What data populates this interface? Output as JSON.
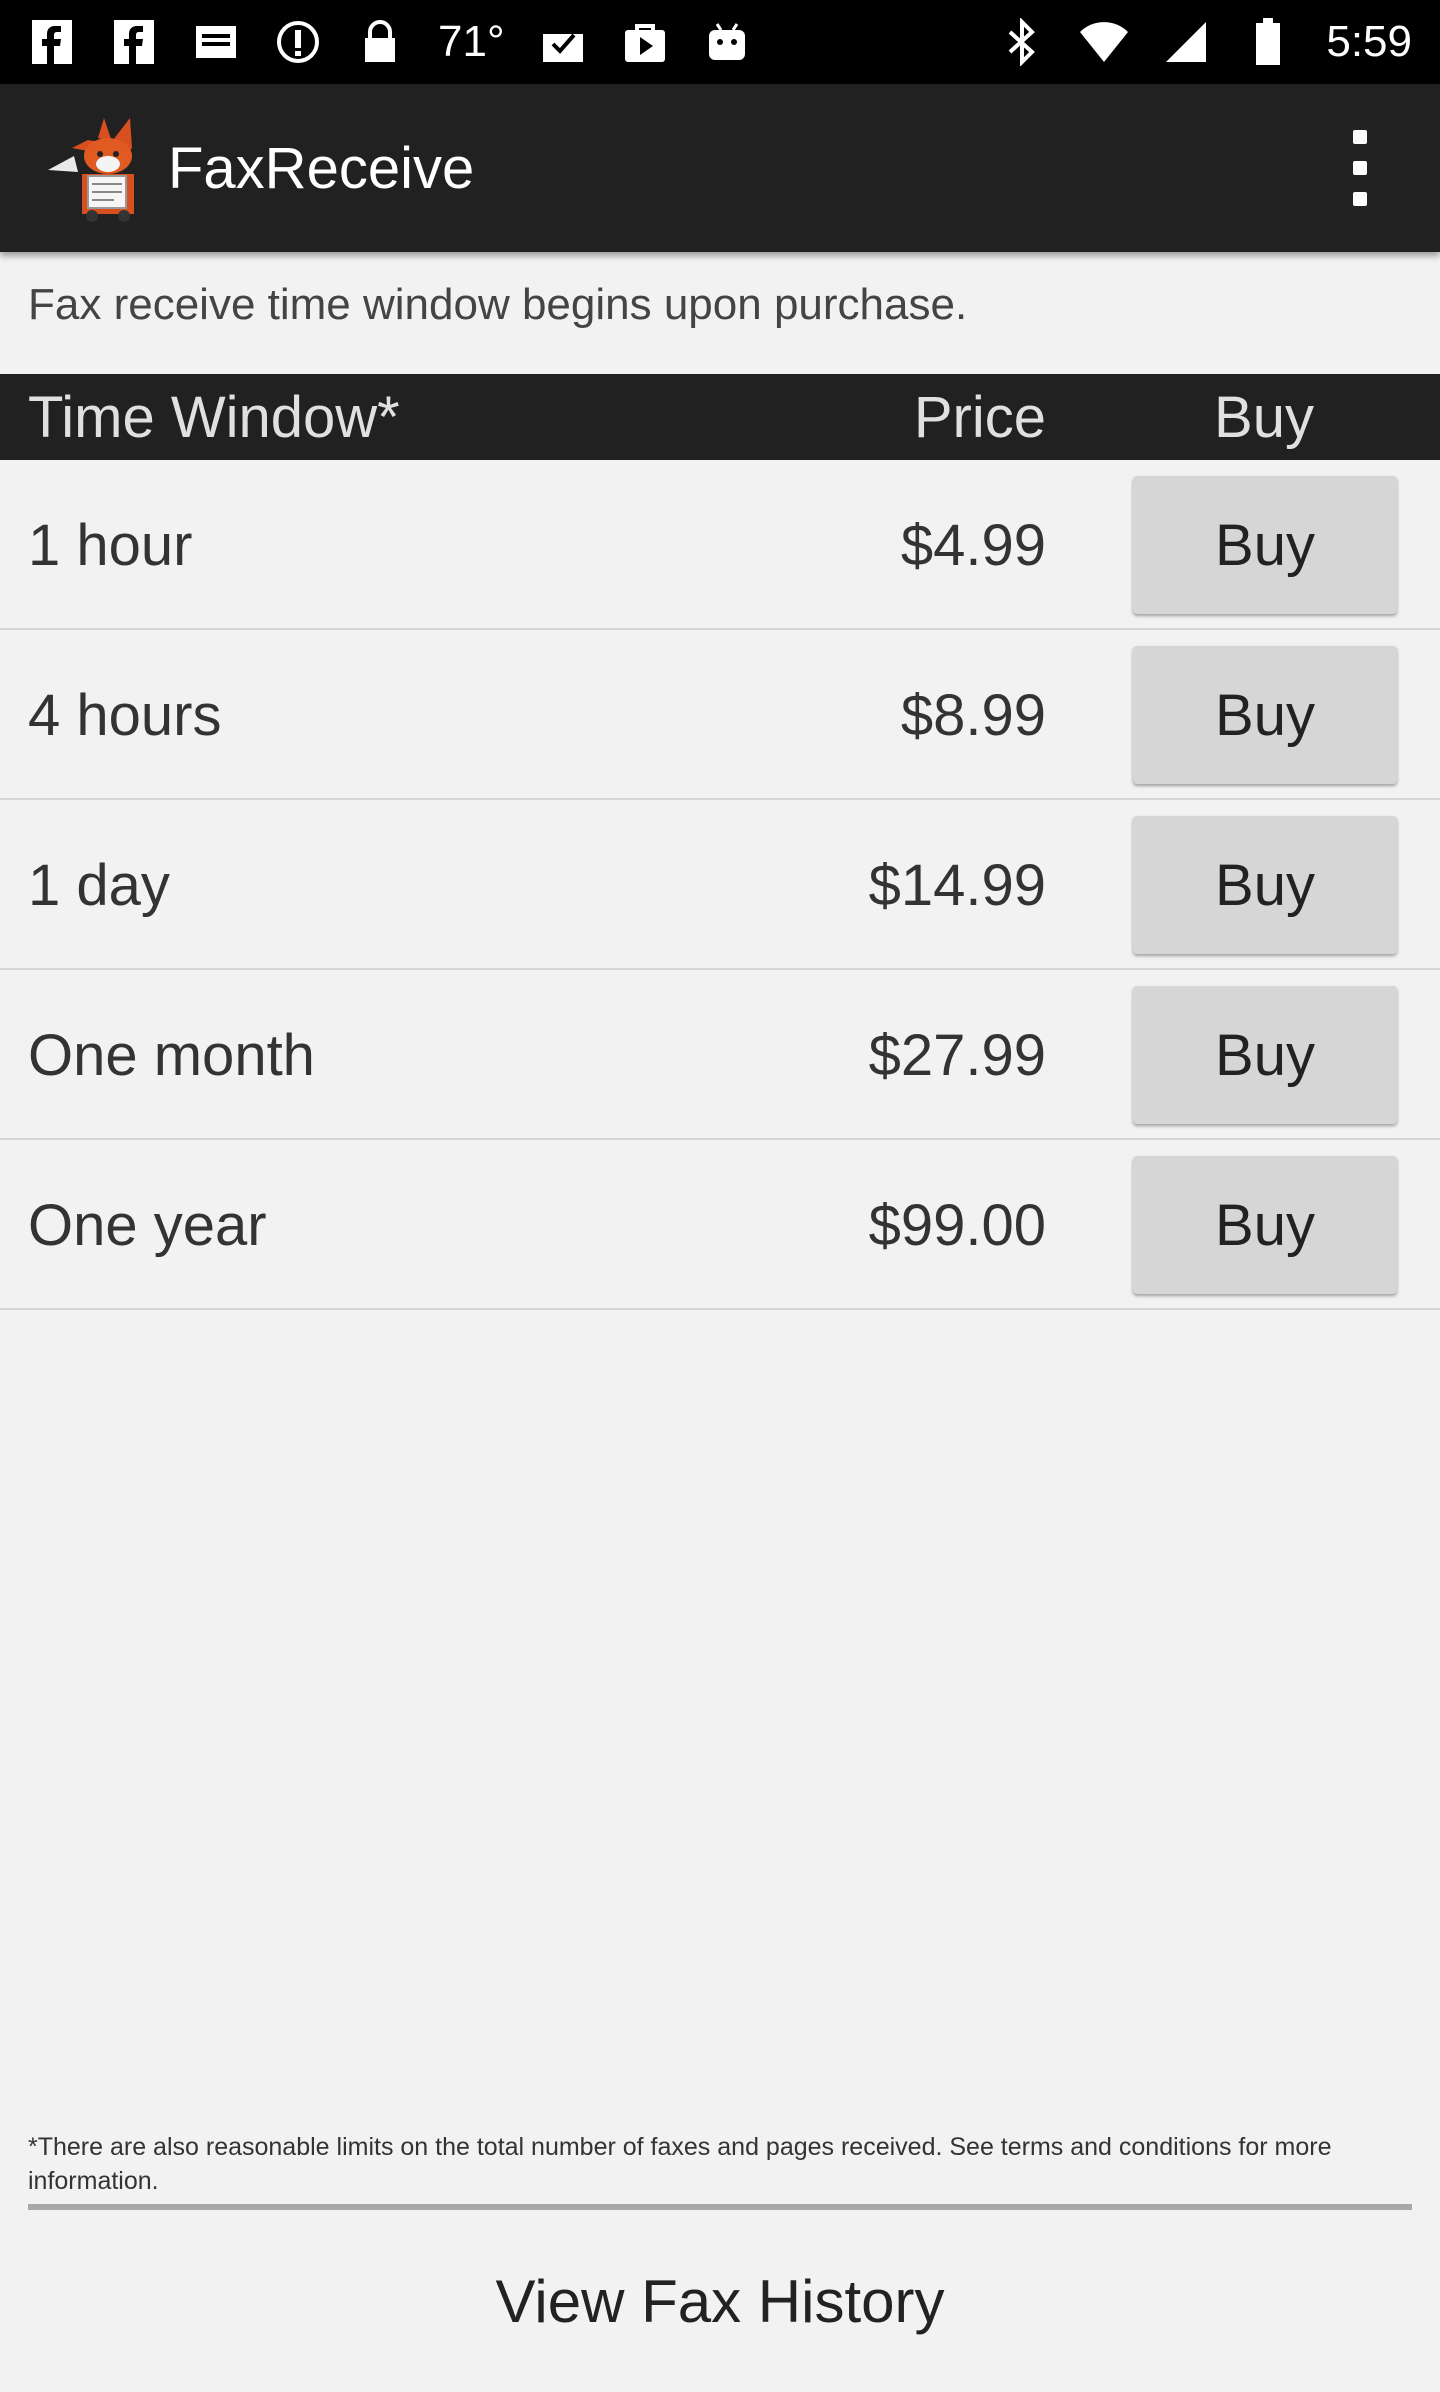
{
  "status_bar": {
    "temperature": "71°",
    "time": "5:59"
  },
  "app_bar": {
    "title": "FaxReceive"
  },
  "notice": "Fax receive time window begins upon purchase.",
  "table": {
    "headers": {
      "time_window": "Time Window*",
      "price": "Price",
      "buy": "Buy"
    },
    "rows": [
      {
        "label": "1 hour",
        "price": "$4.99",
        "button": "Buy"
      },
      {
        "label": "4 hours",
        "price": "$8.99",
        "button": "Buy"
      },
      {
        "label": "1 day",
        "price": "$14.99",
        "button": "Buy"
      },
      {
        "label": "One month",
        "price": "$27.99",
        "button": "Buy"
      },
      {
        "label": "One year",
        "price": "$99.00",
        "button": "Buy"
      }
    ]
  },
  "footnote": "*There are also reasonable limits on the total number of faxes and pages received. See terms and conditions for more information.",
  "footer": {
    "history_label": "View Fax History"
  }
}
